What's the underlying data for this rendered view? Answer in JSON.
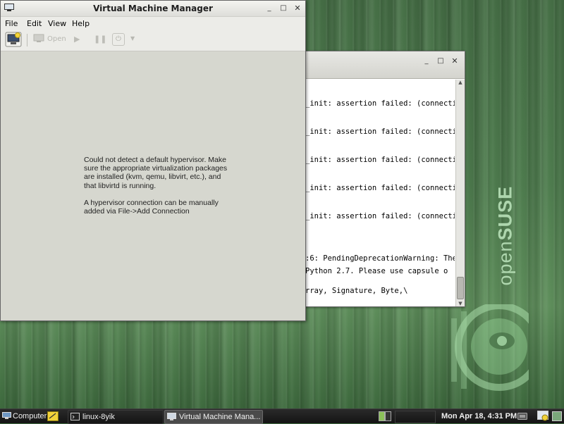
{
  "desktop": {
    "brand_prefix": "open",
    "brand_suffix": "SUSE"
  },
  "terminal": {
    "lines": [
      "_init: assertion failed: (connecti",
      "_init: assertion failed: (connecti",
      "_init: assertion failed: (connecti",
      "_init: assertion failed: (connecti",
      "_init: assertion failed: (connecti",
      ":6: PendingDeprecationWarning: The",
      " Python 2.7.  Please use capsule o",
      "rray, Signature, Byte,\\"
    ]
  },
  "vmm": {
    "title": "Virtual Machine Manager",
    "menu": {
      "file": "File",
      "edit": "Edit",
      "view": "View",
      "help": "Help"
    },
    "toolbar": {
      "open_label": "Open"
    },
    "message_1": "Could not detect a default hypervisor. Make sure the appropriate virtualization packages are installed (kvm, qemu, libvirt, etc.), and that libvirtd is running.",
    "message_2": "A hypervisor connection can be manually added via File->Add Connection"
  },
  "panel": {
    "computer": "Computer",
    "tasks": [
      {
        "label": "linux-8yik",
        "active": false
      },
      {
        "label": "Virtual Machine Mana...",
        "active": true
      }
    ],
    "clock": "Mon Apr 18,  4:31 PM"
  },
  "colors": {
    "panel_bg": "#1c1c1c",
    "desktop_green": "#4f7d4f",
    "window_bg": "#d6d7cf"
  }
}
